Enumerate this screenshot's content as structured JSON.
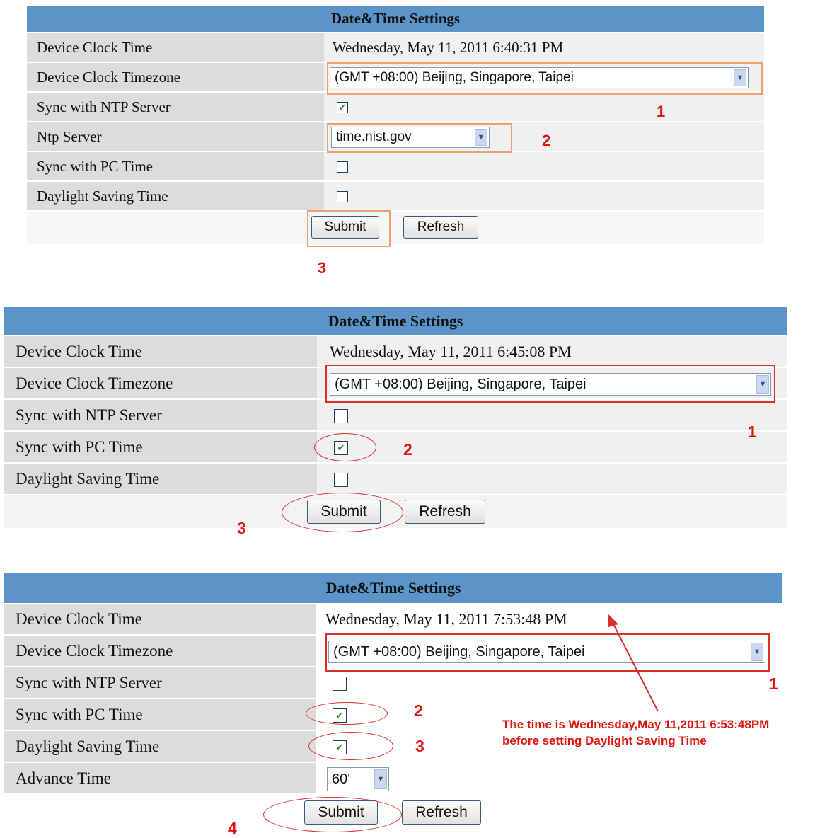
{
  "panels": [
    {
      "title": "Date&Time Settings",
      "rows": [
        {
          "label": "Device Clock Time",
          "value": "Wednesday, May 11, 2011 6:40:31 PM"
        },
        {
          "label": "Device Clock Timezone",
          "value": "(GMT +08:00) Beijing, Singapore, Taipei"
        },
        {
          "label": "Sync with NTP Server",
          "checked": true
        },
        {
          "label": "Ntp Server",
          "value": "time.nist.gov"
        },
        {
          "label": "Sync with PC Time",
          "checked": false
        },
        {
          "label": "Daylight Saving Time",
          "checked": false
        }
      ],
      "submit": "Submit",
      "refresh": "Refresh",
      "annotations": [
        "1",
        "2",
        "3"
      ]
    },
    {
      "title": "Date&Time Settings",
      "rows": [
        {
          "label": "Device Clock Time",
          "value": "Wednesday, May 11, 2011 6:45:08 PM"
        },
        {
          "label": "Device Clock Timezone",
          "value": "(GMT +08:00) Beijing, Singapore, Taipei"
        },
        {
          "label": "Sync with NTP Server",
          "checked": false
        },
        {
          "label": "Sync with PC Time",
          "checked": true
        },
        {
          "label": "Daylight Saving Time",
          "checked": false
        }
      ],
      "submit": "Submit",
      "refresh": "Refresh",
      "annotations": [
        "1",
        "2",
        "3"
      ]
    },
    {
      "title": "Date&Time Settings",
      "rows": [
        {
          "label": "Device Clock Time",
          "value": "Wednesday, May 11, 2011 7:53:48 PM"
        },
        {
          "label": "Device Clock Timezone",
          "value": "(GMT +08:00) Beijing, Singapore, Taipei"
        },
        {
          "label": "Sync with NTP Server",
          "checked": false
        },
        {
          "label": "Sync with PC Time",
          "checked": true
        },
        {
          "label": "Daylight Saving Time",
          "checked": true
        },
        {
          "label": "Advance Time",
          "value": "60'"
        }
      ],
      "submit": "Submit",
      "refresh": "Refresh",
      "annotations": [
        "1",
        "2",
        "3",
        "4"
      ],
      "note": [
        "The time is Wednesday,May 11,2011 6:53:48PM",
        "before setting Daylight Saving Time"
      ]
    }
  ],
  "colors": {
    "header": "#5b94c8",
    "label_bg": "#dcdcdc",
    "annotation": "#e0140d"
  },
  "icons": {
    "dropdown": "chevron-down-icon",
    "checkbox_checked": "check-icon"
  }
}
